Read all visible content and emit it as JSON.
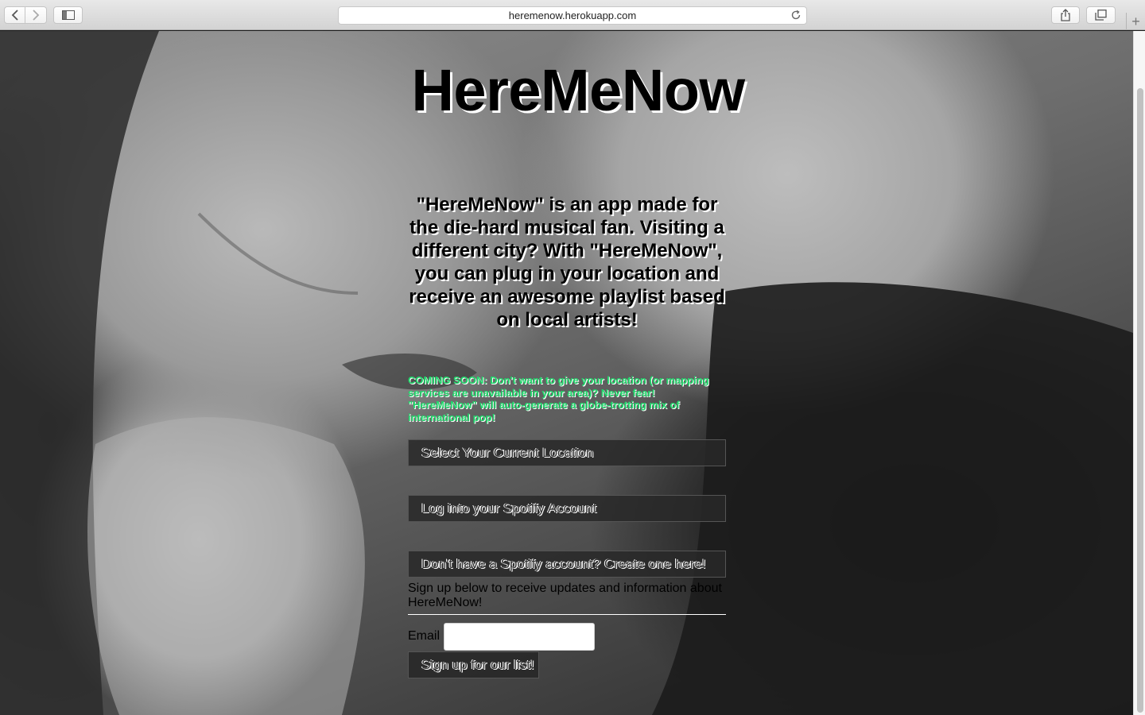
{
  "browser": {
    "url": "heremenow.herokuapp.com",
    "new_tab_glyph": "+",
    "icons": {
      "back": "chevron-left-icon",
      "forward": "chevron-right-icon",
      "sidebar": "sidebar-icon",
      "reload": "reload-icon",
      "share": "share-icon",
      "tabs": "tabs-icon"
    }
  },
  "page": {
    "title": "HereMeNow",
    "intro": "\"HereMeNow\" is an app made for the die-hard musical fan. Visiting a different city? With \"HereMeNow\", you can plug in your location and receive an awesome playlist based on local artists!",
    "coming_soon": "COMING SOON: Don't want to give your location (or mapping services are unavailable in your area)? Never fear! \"HereMeNow\" will auto-generate a globe-trotting mix of international pop!",
    "buttons": {
      "select_location": "Select Your Current Location",
      "spotify_login": "Log into your Spotify Account",
      "spotify_create": "Don't have a Spotify account? Create one here!"
    },
    "signup": {
      "text": "Sign up below to receive updates and information about HereMeNow!",
      "email_label": "Email",
      "email_value": "",
      "submit_label": "Sign up for our list!"
    }
  },
  "colors": {
    "coming_soon_text": "#1fd66a",
    "button_background": "#282828"
  }
}
